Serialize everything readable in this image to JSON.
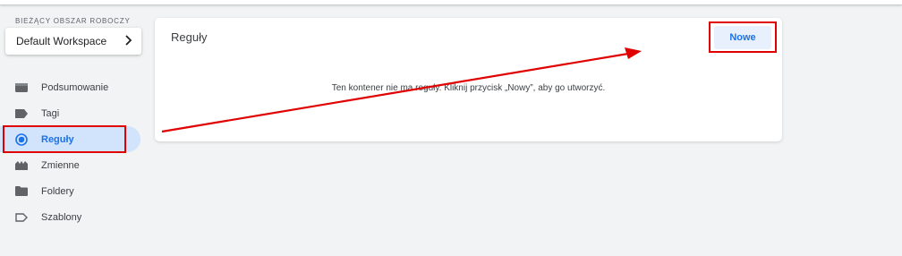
{
  "workspace": {
    "section_label": "BIEŻĄCY OBSZAR ROBOCZY",
    "name": "Default Workspace"
  },
  "sidebar": {
    "items": [
      {
        "label": "Podsumowanie",
        "icon": "summary-icon"
      },
      {
        "label": "Tagi",
        "icon": "tag-icon"
      },
      {
        "label": "Reguły",
        "icon": "trigger-icon",
        "active": true
      },
      {
        "label": "Zmienne",
        "icon": "variable-icon"
      },
      {
        "label": "Foldery",
        "icon": "folder-icon"
      },
      {
        "label": "Szablony",
        "icon": "template-icon"
      }
    ]
  },
  "main": {
    "title": "Reguły",
    "new_button_label": "Nowe",
    "empty_message": "Ten kontener nie ma reguły. Kliknij przycisk „Nowy”, aby go utworzyć."
  },
  "colors": {
    "accent": "#1a73e8",
    "active_bg": "#d2e3fc",
    "annotation": "#e00000",
    "background": "#f1f3f4"
  }
}
